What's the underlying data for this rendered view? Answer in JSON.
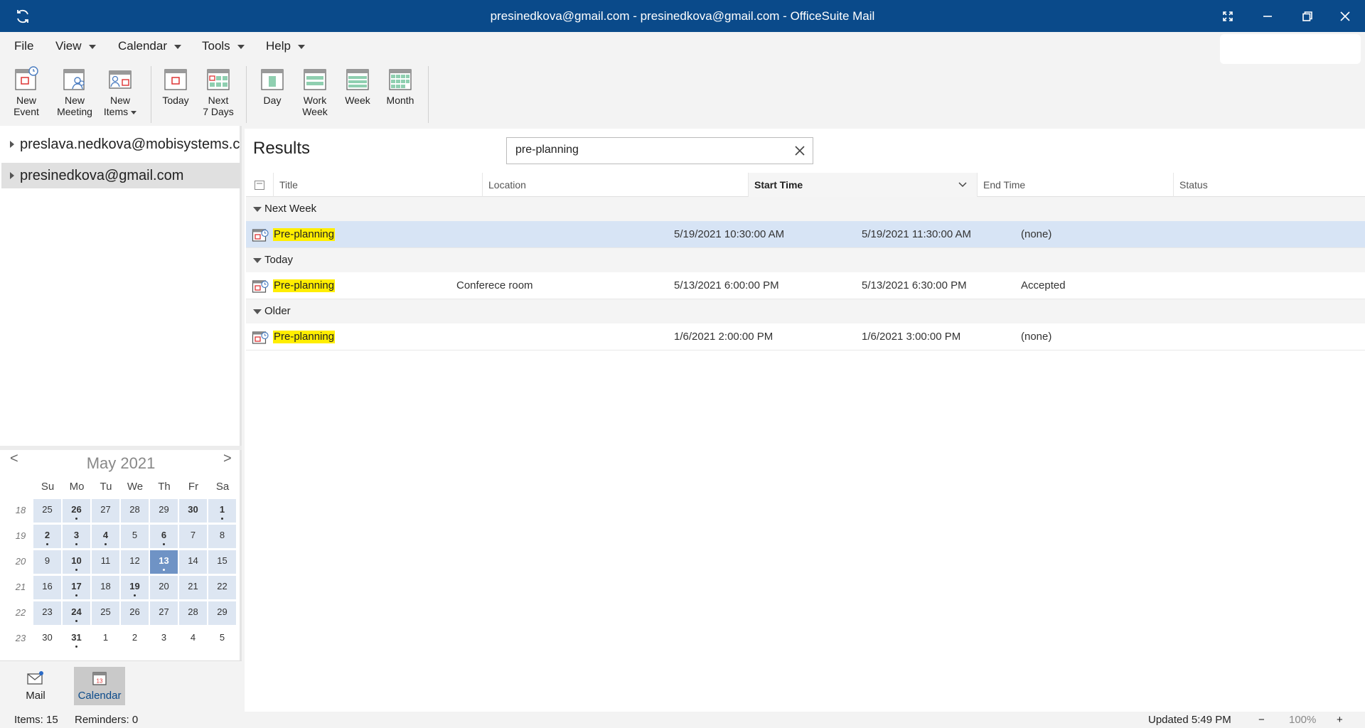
{
  "window": {
    "title": "presinedkova@gmail.com - presinedkova@gmail.com - OfficeSuite Mail"
  },
  "menu": {
    "file": "File",
    "view": "View",
    "calendar": "Calendar",
    "tools": "Tools",
    "help": "Help"
  },
  "ribbon": {
    "new_event_1": "New",
    "new_event_2": "Event",
    "new_meeting_1": "New",
    "new_meeting_2": "Meeting",
    "new_items_1": "New",
    "new_items_2": "Items",
    "today": "Today",
    "next7_1": "Next",
    "next7_2": "7 Days",
    "day": "Day",
    "workweek_1": "Work",
    "workweek_2": "Week",
    "week": "Week",
    "month": "Month"
  },
  "accounts": [
    {
      "label": "preslava.nedkova@mobisystems.com"
    },
    {
      "label": "presinedkova@gmail.com"
    }
  ],
  "mini_calendar": {
    "month_label": "May 2021",
    "prev": "<",
    "next": ">",
    "weekdays": [
      "Su",
      "Mo",
      "Tu",
      "We",
      "Th",
      "Fr",
      "Sa"
    ],
    "weeks": [
      {
        "num": "18",
        "days": [
          {
            "d": "25",
            "in": true,
            "b": false,
            "e": false
          },
          {
            "d": "26",
            "in": true,
            "b": true,
            "e": true
          },
          {
            "d": "27",
            "in": true,
            "b": false,
            "e": false
          },
          {
            "d": "28",
            "in": true,
            "b": false,
            "e": false
          },
          {
            "d": "29",
            "in": true,
            "b": false,
            "e": false
          },
          {
            "d": "30",
            "in": true,
            "b": true,
            "e": false
          },
          {
            "d": "1",
            "in": true,
            "b": true,
            "e": true
          }
        ]
      },
      {
        "num": "19",
        "days": [
          {
            "d": "2",
            "in": true,
            "b": true,
            "e": true
          },
          {
            "d": "3",
            "in": true,
            "b": true,
            "e": true
          },
          {
            "d": "4",
            "in": true,
            "b": true,
            "e": true
          },
          {
            "d": "5",
            "in": true,
            "b": false,
            "e": false
          },
          {
            "d": "6",
            "in": true,
            "b": true,
            "e": true
          },
          {
            "d": "7",
            "in": true,
            "b": false,
            "e": false
          },
          {
            "d": "8",
            "in": true,
            "b": false,
            "e": false
          }
        ]
      },
      {
        "num": "20",
        "days": [
          {
            "d": "9",
            "in": true,
            "b": false,
            "e": false
          },
          {
            "d": "10",
            "in": true,
            "b": true,
            "e": true
          },
          {
            "d": "11",
            "in": true,
            "b": false,
            "e": false
          },
          {
            "d": "12",
            "in": true,
            "b": false,
            "e": false
          },
          {
            "d": "13",
            "in": true,
            "b": true,
            "e": true,
            "today": true
          },
          {
            "d": "14",
            "in": true,
            "b": false,
            "e": false
          },
          {
            "d": "15",
            "in": true,
            "b": false,
            "e": false
          }
        ]
      },
      {
        "num": "21",
        "days": [
          {
            "d": "16",
            "in": true,
            "b": false,
            "e": false
          },
          {
            "d": "17",
            "in": true,
            "b": true,
            "e": true
          },
          {
            "d": "18",
            "in": true,
            "b": false,
            "e": false
          },
          {
            "d": "19",
            "in": true,
            "b": true,
            "e": true
          },
          {
            "d": "20",
            "in": true,
            "b": false,
            "e": false
          },
          {
            "d": "21",
            "in": true,
            "b": false,
            "e": false
          },
          {
            "d": "22",
            "in": true,
            "b": false,
            "e": false
          }
        ]
      },
      {
        "num": "22",
        "days": [
          {
            "d": "23",
            "in": true,
            "b": false,
            "e": false
          },
          {
            "d": "24",
            "in": true,
            "b": true,
            "e": true
          },
          {
            "d": "25",
            "in": true,
            "b": false,
            "e": false
          },
          {
            "d": "26",
            "in": true,
            "b": false,
            "e": false
          },
          {
            "d": "27",
            "in": true,
            "b": false,
            "e": false
          },
          {
            "d": "28",
            "in": true,
            "b": false,
            "e": false
          },
          {
            "d": "29",
            "in": true,
            "b": false,
            "e": false
          }
        ]
      },
      {
        "num": "23",
        "days": [
          {
            "d": "30",
            "in": false,
            "b": false,
            "e": false
          },
          {
            "d": "31",
            "in": false,
            "b": true,
            "e": true
          },
          {
            "d": "1",
            "in": false,
            "b": false,
            "e": false
          },
          {
            "d": "2",
            "in": false,
            "b": false,
            "e": false
          },
          {
            "d": "3",
            "in": false,
            "b": false,
            "e": false
          },
          {
            "d": "4",
            "in": false,
            "b": false,
            "e": false
          },
          {
            "d": "5",
            "in": false,
            "b": false,
            "e": false
          }
        ]
      }
    ]
  },
  "nav": {
    "mail": "Mail",
    "calendar": "Calendar",
    "calendar_icon_day": "13"
  },
  "results": {
    "title": "Results",
    "search_value": "pre-planning",
    "columns": {
      "title": "Title",
      "location": "Location",
      "start": "Start Time",
      "end": "End Time",
      "status": "Status"
    },
    "groups": [
      {
        "label": "Next Week",
        "rows": [
          {
            "title": "Pre-planning",
            "location": "",
            "start": "5/19/2021 10:30:00 AM",
            "end": "5/19/2021 11:30:00 AM",
            "status": "(none)",
            "selected": true
          }
        ]
      },
      {
        "label": "Today",
        "rows": [
          {
            "title": "Pre-planning",
            "location": "Conferece room",
            "start": "5/13/2021 6:00:00 PM",
            "end": "5/13/2021 6:30:00 PM",
            "status": "Accepted",
            "selected": false
          }
        ]
      },
      {
        "label": "Older",
        "rows": [
          {
            "title": "Pre-planning",
            "location": "",
            "start": "1/6/2021 2:00:00 PM",
            "end": "1/6/2021 3:00:00 PM",
            "status": "(none)",
            "selected": false
          }
        ]
      }
    ]
  },
  "status": {
    "items": "Items: 15",
    "reminders": "Reminders: 0",
    "updated": "Updated 5:49 PM",
    "zoom_minus": "−",
    "zoom": "100%",
    "zoom_plus": "+"
  },
  "colors": {
    "titlebar": "#0a4a8a",
    "highlight": "#ffee00",
    "selected_row": "#d7e4f5",
    "today_cell": "#6f93c5"
  }
}
